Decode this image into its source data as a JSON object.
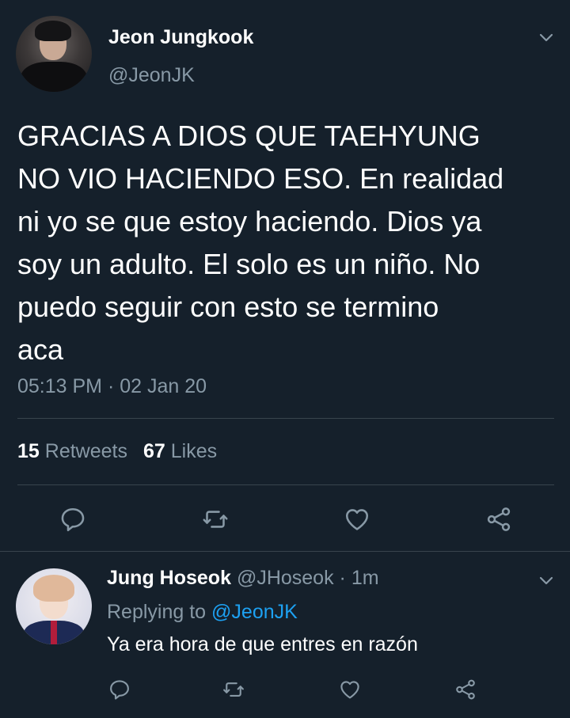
{
  "main_tweet": {
    "display_name": "Jeon Jungkook",
    "handle": "@JeonJK",
    "text": "GRACIAS A DIOS QUE TAEHYUNG\nNO VIO HACIENDO ESO. En realidad\nni yo se que estoy haciendo. Dios ya\nsoy un adulto. El solo es un niño. No\npuedo seguir con esto se termino\naca",
    "timestamp": "05:13 PM · 02 Jan 20",
    "retweets_count": "15",
    "retweets_label": "Retweets",
    "likes_count": "67",
    "likes_label": "Likes",
    "actions": [
      "reply-icon",
      "retweet-icon",
      "like-icon",
      "share-icon"
    ]
  },
  "reply_tweet": {
    "display_name": "Jung Hoseok",
    "handle": "@JHoseok",
    "separator": "·",
    "time_ago": "1m",
    "replying_prefix": "Replying to",
    "replying_to": "@JeonJK",
    "text": "Ya era hora de que entres en razón",
    "actions": [
      "reply-icon",
      "retweet-icon",
      "like-icon",
      "share-icon"
    ]
  },
  "colors": {
    "background": "#15202b",
    "text_primary": "#ffffff",
    "text_secondary": "#8899a6",
    "accent": "#1da1f2",
    "divider": "#38444d"
  }
}
